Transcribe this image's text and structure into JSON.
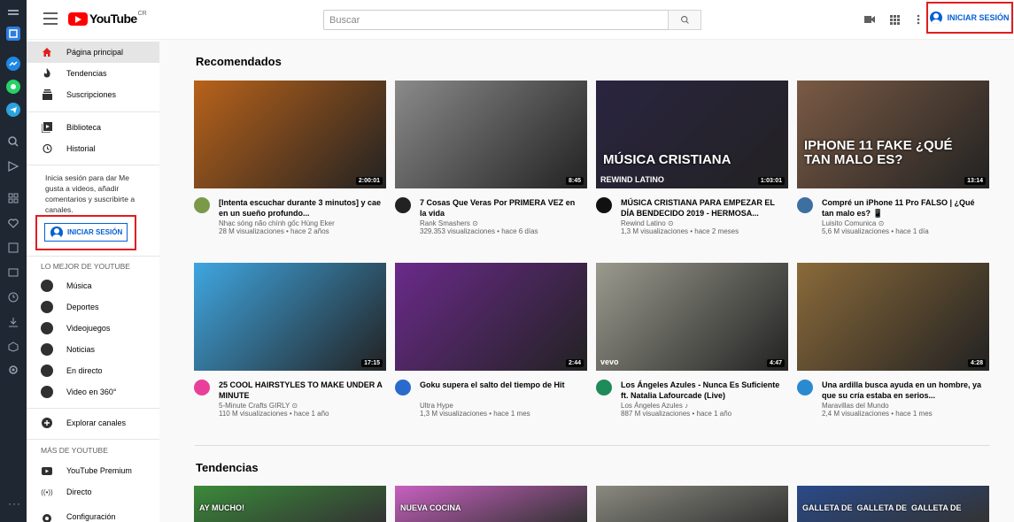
{
  "masthead": {
    "logo_text": "YouTube",
    "logo_region": "CR",
    "search_placeholder": "Buscar",
    "signin_label": "INICIAR SESIÓN"
  },
  "sidebar": {
    "main_items": [
      {
        "label": "Página principal",
        "icon": "home-icon"
      },
      {
        "label": "Tendencias",
        "icon": "flame-icon"
      },
      {
        "label": "Suscripciones",
        "icon": "subscriptions-icon"
      }
    ],
    "lib_items": [
      {
        "label": "Biblioteca",
        "icon": "library-icon"
      },
      {
        "label": "Historial",
        "icon": "history-icon"
      }
    ],
    "signin_text": "Inicia sesión para dar Me gusta a videos, añadir comentarios y suscribirte a canales.",
    "signin_button": "INICIAR SESIÓN",
    "best_heading": "LO MEJOR DE YOUTUBE",
    "best_items": [
      {
        "label": "Música",
        "icon": "music-icon"
      },
      {
        "label": "Deportes",
        "icon": "sports-icon"
      },
      {
        "label": "Videojuegos",
        "icon": "gaming-icon"
      },
      {
        "label": "Noticias",
        "icon": "news-icon"
      },
      {
        "label": "En directo",
        "icon": "live-icon"
      },
      {
        "label": "Video en 360°",
        "icon": "360-icon"
      }
    ],
    "explore_label": "Explorar canales",
    "more_heading": "MÁS DE YOUTUBE",
    "more_items": [
      {
        "label": "YouTube Premium",
        "icon": "youtube-premium-icon"
      },
      {
        "label": "Directo",
        "icon": "broadcast-icon"
      },
      {
        "label": "Configuración",
        "icon": "settings-icon"
      }
    ]
  },
  "main": {
    "recommended_title": "Recomendados",
    "trending_title": "Tendencias",
    "videos": [
      {
        "title": "[Intenta escuchar durante 3 minutos] y cae en un sueño profundo...",
        "channel": "Nhạc sóng não chính gốc Hùng Eker",
        "meta": "28 M visualizaciones • hace 2 años",
        "duration": "2:00:01",
        "thumb_color": "#b8621a",
        "avatar_color": "#7a9a4a"
      },
      {
        "title": "7 Cosas Que Veras Por PRIMERA VEZ en la vida",
        "channel": "Rank Smashers ⊙",
        "meta": "329.353 visualizaciones • hace 6 días",
        "duration": "8:45",
        "thumb_color": "#8a8a8a",
        "avatar_color": "#222222"
      },
      {
        "title": "MÚSICA CRISTIANA PARA EMPEZAR EL DÍA BENDECIDO 2019 - HERMOSA...",
        "channel": "Rewind Latino ⊙",
        "meta": "1,3 M visualizaciones • hace 2 meses",
        "duration": "1:03:01",
        "thumb_color": "#2a2440",
        "avatar_color": "#111111",
        "overlay_text": "MÚSICA CRISTIANA",
        "corner_text": "REWIND LATINO"
      },
      {
        "title": "Compré un iPhone 11 Pro FALSO | ¿Qué tan malo es? 📱",
        "channel": "Luisito Comunica ⊙",
        "meta": "5,6 M visualizaciones • hace 1 día",
        "duration": "13:14",
        "thumb_color": "#7a5a44",
        "avatar_color": "#3d6fa0",
        "overlay_text": "IPHONE 11 FAKE ¿QUÉ TAN MALO ES?"
      },
      {
        "title": "25 COOL HAIRSTYLES TO MAKE UNDER A MINUTE",
        "channel": "5-Minute Crafts GIRLY ⊙",
        "meta": "110 M visualizaciones • hace 1 año",
        "duration": "17:15",
        "thumb_color": "#3fa6e0",
        "avatar_color": "#e8409a"
      },
      {
        "title": "Goku supera el salto del tiempo de Hit",
        "channel": "Ultra Hype",
        "meta": "1,3 M visualizaciones • hace 1 mes",
        "duration": "2:44",
        "thumb_color": "#6a2a8a",
        "avatar_color": "#2a6acc"
      },
      {
        "title": "Los Ángeles Azules - Nunca Es Suficiente ft. Natalia Lafourcade (Live)",
        "channel": "Los Ángeles Azules ♪",
        "meta": "887 M visualizaciones • hace 1 año",
        "duration": "4:47",
        "thumb_color": "#9a9a8e",
        "avatar_color": "#1f8a5a",
        "corner_text": "vevo"
      },
      {
        "title": "Una ardilla busca ayuda en un hombre, ya que su cría estaba en serios...",
        "channel": "Maravillas del Mundo",
        "meta": "2,4 M visualizaciones • hace 1 mes",
        "duration": "4:28",
        "thumb_color": "#8a6a3a",
        "avatar_color": "#2a8ad0"
      }
    ],
    "trending_thumbs": [
      {
        "color": "#3a8a3a",
        "text": "AY MUCHO!"
      },
      {
        "color": "#c860c0",
        "text": "NUEVA COCINA"
      },
      {
        "color": "#8a8a80",
        "text": ""
      },
      {
        "color": "#2a4a8a",
        "text": "GALLETA DE  GALLETA DE  GALLETA DE"
      }
    ]
  }
}
